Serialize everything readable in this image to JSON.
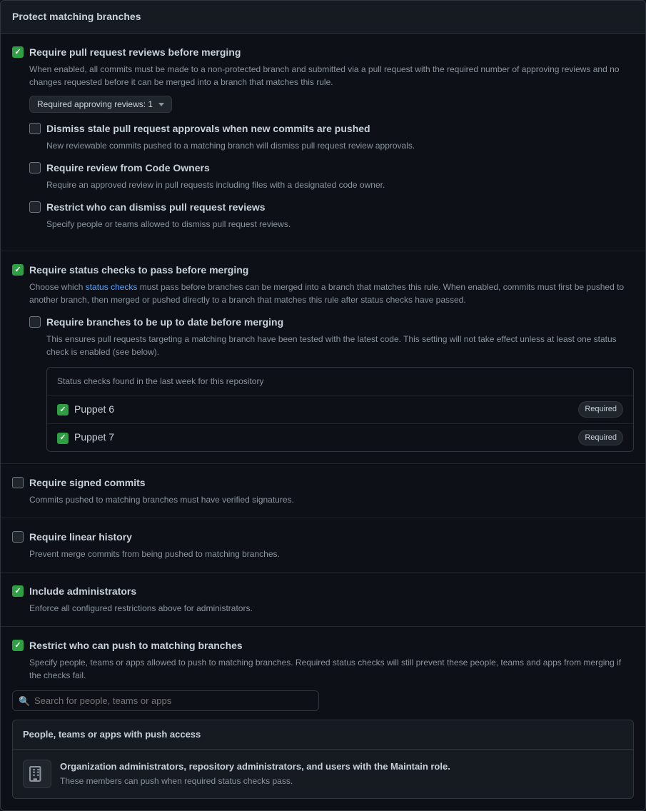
{
  "header": {
    "title": "Protect matching branches"
  },
  "sections": {
    "pull_request_reviews": {
      "checked": true,
      "title": "Require pull request reviews before merging",
      "description": "When enabled, all commits must be made to a non-protected branch and submitted via a pull request with the required number of approving reviews and no changes requested before it can be merged into a branch that matches this rule.",
      "dropdown_label": "Required approving reviews: 1",
      "sub_options": [
        {
          "id": "dismiss_stale",
          "checked": false,
          "title": "Dismiss stale pull request approvals when new commits are pushed",
          "description": "New reviewable commits pushed to a matching branch will dismiss pull request review approvals."
        },
        {
          "id": "require_code_owners",
          "checked": false,
          "title": "Require review from Code Owners",
          "description": "Require an approved review in pull requests including files with a designated code owner."
        },
        {
          "id": "restrict_dismiss",
          "checked": false,
          "title": "Restrict who can dismiss pull request reviews",
          "description": "Specify people or teams allowed to dismiss pull request reviews."
        }
      ]
    },
    "status_checks": {
      "checked": true,
      "title": "Require status checks to pass before merging",
      "description_before_link": "Choose which ",
      "link_text": "status checks",
      "link_href": "#",
      "description_after_link": " must pass before branches can be merged into a branch that matches this rule. When enabled, commits must first be pushed to another branch, then merged or pushed directly to a branch that matches this rule after status checks have passed.",
      "sub_options": [
        {
          "id": "up_to_date",
          "checked": false,
          "title": "Require branches to be up to date before merging",
          "description": "This ensures pull requests targeting a matching branch have been tested with the latest code. This setting will not take effect unless at least one status check is enabled (see below)."
        }
      ],
      "status_checks_box": {
        "header": "Status checks found in the last week for this repository",
        "items": [
          {
            "name": "Puppet 6",
            "required": true,
            "checked": true
          },
          {
            "name": "Puppet 7",
            "required": true,
            "checked": true
          }
        ],
        "required_label": "Required"
      }
    },
    "signed_commits": {
      "checked": false,
      "title": "Require signed commits",
      "description": "Commits pushed to matching branches must have verified signatures."
    },
    "linear_history": {
      "checked": false,
      "title": "Require linear history",
      "description": "Prevent merge commits from being pushed to matching branches."
    },
    "include_admins": {
      "checked": true,
      "title": "Include administrators",
      "description": "Enforce all configured restrictions above for administrators."
    },
    "restrict_push": {
      "checked": true,
      "title": "Restrict who can push to matching branches",
      "description": "Specify people, teams or apps allowed to push to matching branches. Required status checks will still prevent these people, teams and apps from merging if the checks fail.",
      "search_placeholder": "Search for people, teams or apps",
      "people_box": {
        "header": "People, teams or apps with push access",
        "item_title": "Organization administrators, repository administrators, and users with the Maintain role.",
        "item_description": "These members can push when required status checks pass."
      }
    }
  }
}
